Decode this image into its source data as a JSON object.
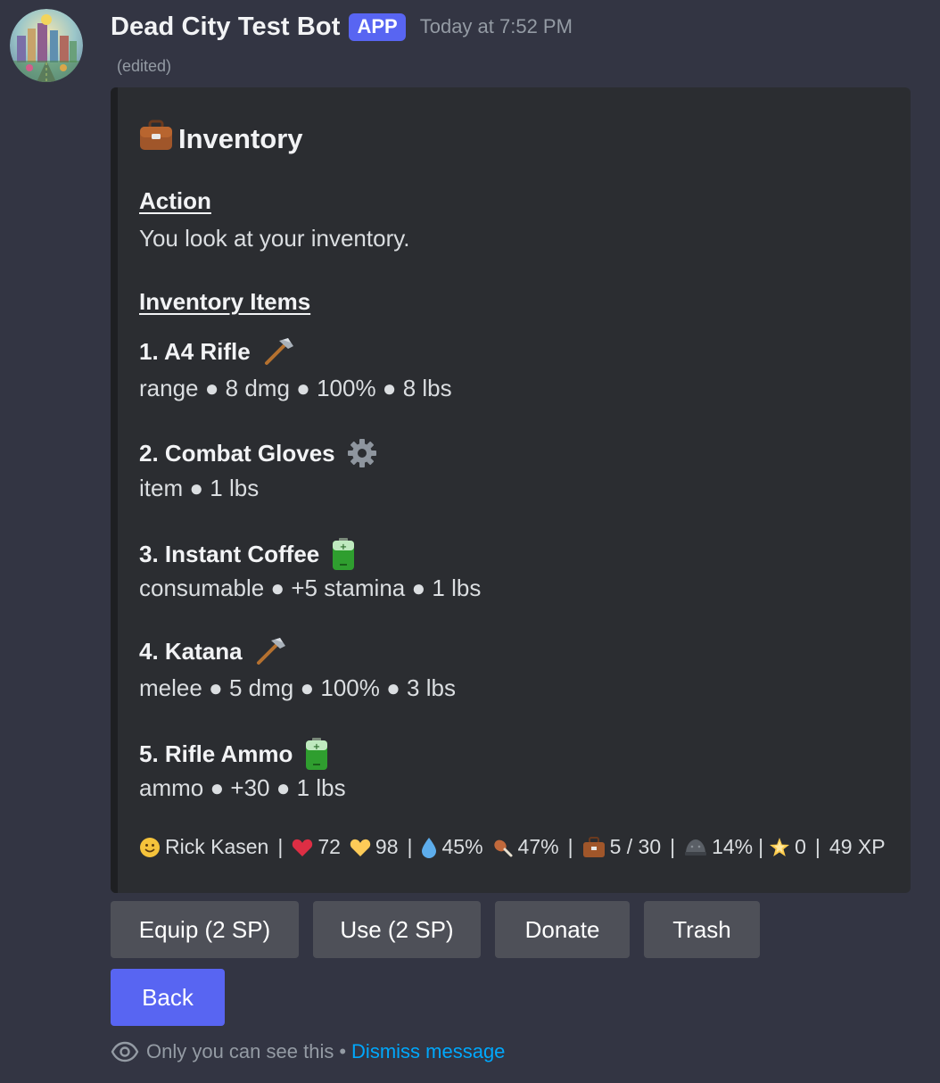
{
  "message": {
    "bot_name": "Dead City Test Bot",
    "badge": "APP",
    "timestamp": "Today at 7:52 PM",
    "edited": "(edited)"
  },
  "embed": {
    "title": "Inventory",
    "title_icon": "briefcase-icon",
    "action_heading": "Action",
    "action_text": "You look at your inventory.",
    "items_heading": "Inventory Items",
    "items": [
      {
        "name": "1.  A4 Rifle",
        "icon": "axe-icon",
        "desc": "range ● 8 dmg ● 100% ● 8 lbs"
      },
      {
        "name": "2.  Combat Gloves",
        "icon": "gear-icon",
        "desc": "item ● 1 lbs"
      },
      {
        "name": "3.  Instant Coffee",
        "icon": "battery-icon",
        "desc": "consumable ● +5 stamina ● 1 lbs"
      },
      {
        "name": "4.  Katana",
        "icon": "axe-icon",
        "desc": "melee ● 5 dmg ● 100% ● 3 lbs"
      },
      {
        "name": "5.  Rifle Ammo",
        "icon": "battery-icon",
        "desc": "ammo ● +30 ● 1 lbs"
      }
    ],
    "footer": {
      "player": "Rick Kasen",
      "health": "72",
      "heart_gold": "98",
      "water": "45%",
      "food": "47%",
      "capacity": "5 / 30",
      "armor": "14%",
      "stars": "0",
      "xp": "49 XP",
      "separator": "|"
    }
  },
  "buttons": {
    "equip": "Equip (2 SP)",
    "use": "Use (2 SP)",
    "donate": "Donate",
    "trash": "Trash",
    "back": "Back"
  },
  "ephemeral": {
    "note": "Only you can see this",
    "dot": "•",
    "dismiss": "Dismiss message"
  },
  "colors": {
    "background": "#333543",
    "embed_bg": "#2b2d31",
    "blurple": "#5865f2",
    "secondary_button": "#4e5058",
    "link": "#00a8fc"
  }
}
